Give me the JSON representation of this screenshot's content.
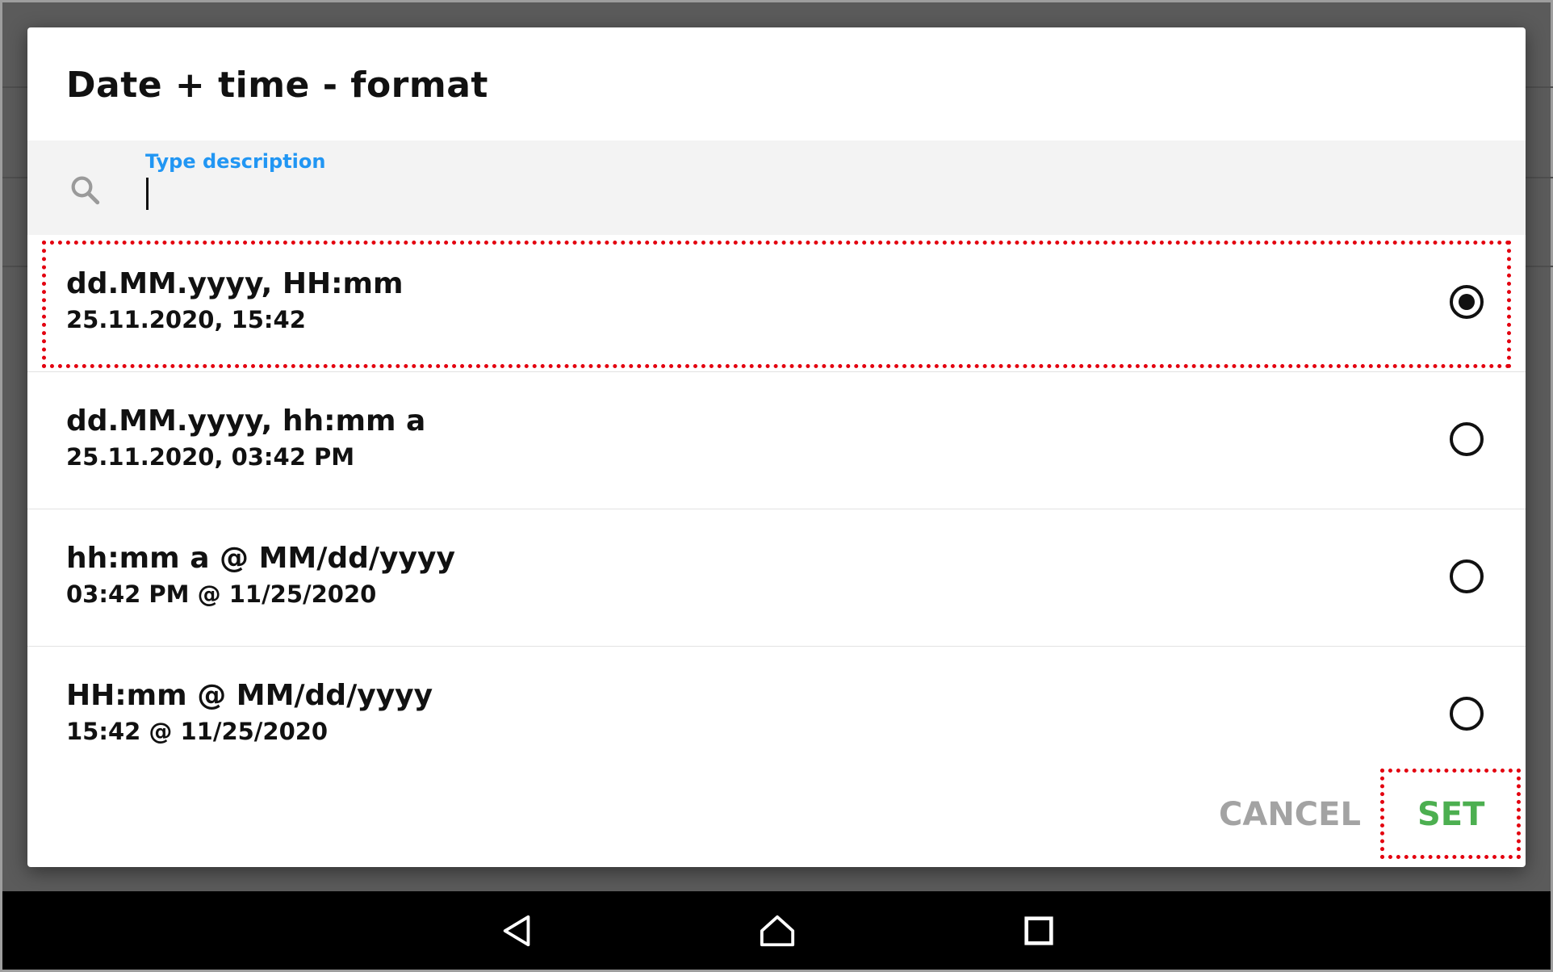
{
  "dialog": {
    "title": "Date + time - format",
    "search": {
      "label": "Type description",
      "value": "",
      "icon": "search-icon"
    },
    "options": [
      {
        "format": "dd.MM.yyyy, HH:mm",
        "example": "25.11.2020, 15:42",
        "selected": true
      },
      {
        "format": "dd.MM.yyyy, hh:mm a",
        "example": "25.11.2020, 03:42 PM",
        "selected": false
      },
      {
        "format": "hh:mm a @ MM/dd/yyyy",
        "example": "03:42 PM @ 11/25/2020",
        "selected": false
      },
      {
        "format": "HH:mm @ MM/dd/yyyy",
        "example": "15:42 @ 11/25/2020",
        "selected": false
      }
    ],
    "buttons": {
      "cancel_label": "CANCEL",
      "set_label": "SET"
    },
    "colors": {
      "accent_label": "#2196f3",
      "set_button": "#4caf50",
      "cancel_button": "#a3a3a3",
      "highlight": "#e3000f"
    }
  },
  "navbar": {
    "back_icon": "back-triangle-icon",
    "home_icon": "home-icon",
    "recents_icon": "recents-square-icon"
  }
}
